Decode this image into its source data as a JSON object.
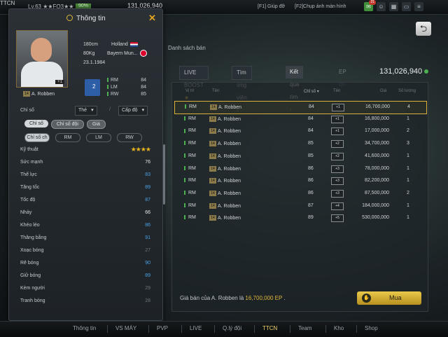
{
  "topbar": {
    "level": "Lv.63 ★★FO3★★",
    "exp_pct": "90%",
    "ep": "131,026,940",
    "mode": "TTCN",
    "hotkey_help": "[F1] Giúp đỡ",
    "hotkey_shot": "[F2]Chụp ảnh màn hình",
    "icon_badge": "21"
  },
  "info_panel": {
    "title": "Thông tin",
    "player": {
      "name": "A. Robben",
      "season_badge": "14",
      "height": "180cm",
      "weight": "80Kg",
      "birthdate": "23.1.1984",
      "nation": "Holland",
      "club": "Bayern Mun...",
      "card_overall": "+1",
      "position_level": "2",
      "positions": [
        {
          "pos": "RM",
          "val": "84"
        },
        {
          "pos": "LM",
          "val": "84"
        },
        {
          "pos": "RW",
          "val": "85"
        }
      ]
    },
    "filter_label": "Chỉ số",
    "filter_the": "Thẻ",
    "filter_level": "Cấp độ",
    "tabs": [
      "Chỉ số",
      "Chỉ số đội",
      "Giá"
    ],
    "pos_tabs": [
      "Chỉ số ch",
      "RM",
      "LM",
      "RW"
    ],
    "stats": [
      {
        "name": "Kỹ thuật",
        "value": "",
        "stars": "★★★★"
      },
      {
        "name": "Sức mạnh",
        "value": "76"
      },
      {
        "name": "Thể lực",
        "value": "83"
      },
      {
        "name": "Tăng tốc",
        "value": "89"
      },
      {
        "name": "Tốc độ",
        "value": "87"
      },
      {
        "name": "Nhảy",
        "value": "66"
      },
      {
        "name": "Khéo léo",
        "value": "86"
      },
      {
        "name": "Thăng bằng",
        "value": "91"
      },
      {
        "name": "Xoạc bóng",
        "value": "27"
      },
      {
        "name": "Rê bóng",
        "value": "90"
      },
      {
        "name": "Giữ bóng",
        "value": "89"
      },
      {
        "name": "Kèm người",
        "value": "29"
      },
      {
        "name": "Tranh bóng",
        "value": "28"
      }
    ],
    "stat_colors": {
      "white": "#e8eaec",
      "blue": "#4aa3e8",
      "grey": "#6d767c"
    }
  },
  "main": {
    "list_label": "Danh sách bán",
    "tabs": [
      "LIVE BOOST",
      "Tìm ứng viên",
      "Kết quả tìm",
      "EP có"
    ],
    "total_ep": "131,026,940",
    "headers": [
      "Vị trí",
      "Tên",
      "Chỉ số",
      "Tên",
      "Giá",
      "Số lượng"
    ],
    "rows": [
      {
        "pos": "RM",
        "badge": "14",
        "name": "A. Robben",
        "ovr": "84",
        "lv": "+1",
        "price": "16,700,000",
        "qty": "4",
        "selected": true
      },
      {
        "pos": "RM",
        "badge": "14",
        "name": "A. Robben",
        "ovr": "84",
        "lv": "+1",
        "price": "16,800,000",
        "qty": "1"
      },
      {
        "pos": "RM",
        "badge": "14",
        "name": "A. Robben",
        "ovr": "84",
        "lv": "+1",
        "price": "17,000,000",
        "qty": "2"
      },
      {
        "pos": "RM",
        "badge": "14",
        "name": "A. Robben",
        "ovr": "85",
        "lv": "+2",
        "price": "34,700,000",
        "qty": "3"
      },
      {
        "pos": "RM",
        "badge": "14",
        "name": "A. Robben",
        "ovr": "85",
        "lv": "+2",
        "price": "41,600,000",
        "qty": "1"
      },
      {
        "pos": "RM",
        "badge": "14",
        "name": "A. Robben",
        "ovr": "86",
        "lv": "+3",
        "price": "78,000,000",
        "qty": "1"
      },
      {
        "pos": "RM",
        "badge": "14",
        "name": "A. Robben",
        "ovr": "86",
        "lv": "+3",
        "price": "82,200,000",
        "qty": "1"
      },
      {
        "pos": "RM",
        "badge": "14",
        "name": "A. Robben",
        "ovr": "86",
        "lv": "+3",
        "price": "87,500,000",
        "qty": "2"
      },
      {
        "pos": "RM",
        "badge": "14",
        "name": "A. Robben",
        "ovr": "87",
        "lv": "+4",
        "price": "184,000,000",
        "qty": "1"
      },
      {
        "pos": "RM",
        "badge": "14",
        "name": "A. Robben",
        "ovr": "89",
        "lv": "+5",
        "price": "530,000,000",
        "qty": "1"
      }
    ],
    "footer_prefix": "Giá bán của A. Robben là",
    "footer_price": "16,700,000 EP",
    "footer_suffix": ".",
    "buy_label": "Mua"
  },
  "bottom_nav": [
    "Thông tin",
    "VS MÁY",
    "PVP",
    "LIVE",
    "Q.lý đội",
    "TTCN",
    "Team",
    "Kho",
    "Shop"
  ],
  "bottom_nav_active": "TTCN",
  "colors": {
    "accent_gold": "#e0b73a",
    "position_green": "#4caf50",
    "stat_blue": "#4aa3e8"
  }
}
